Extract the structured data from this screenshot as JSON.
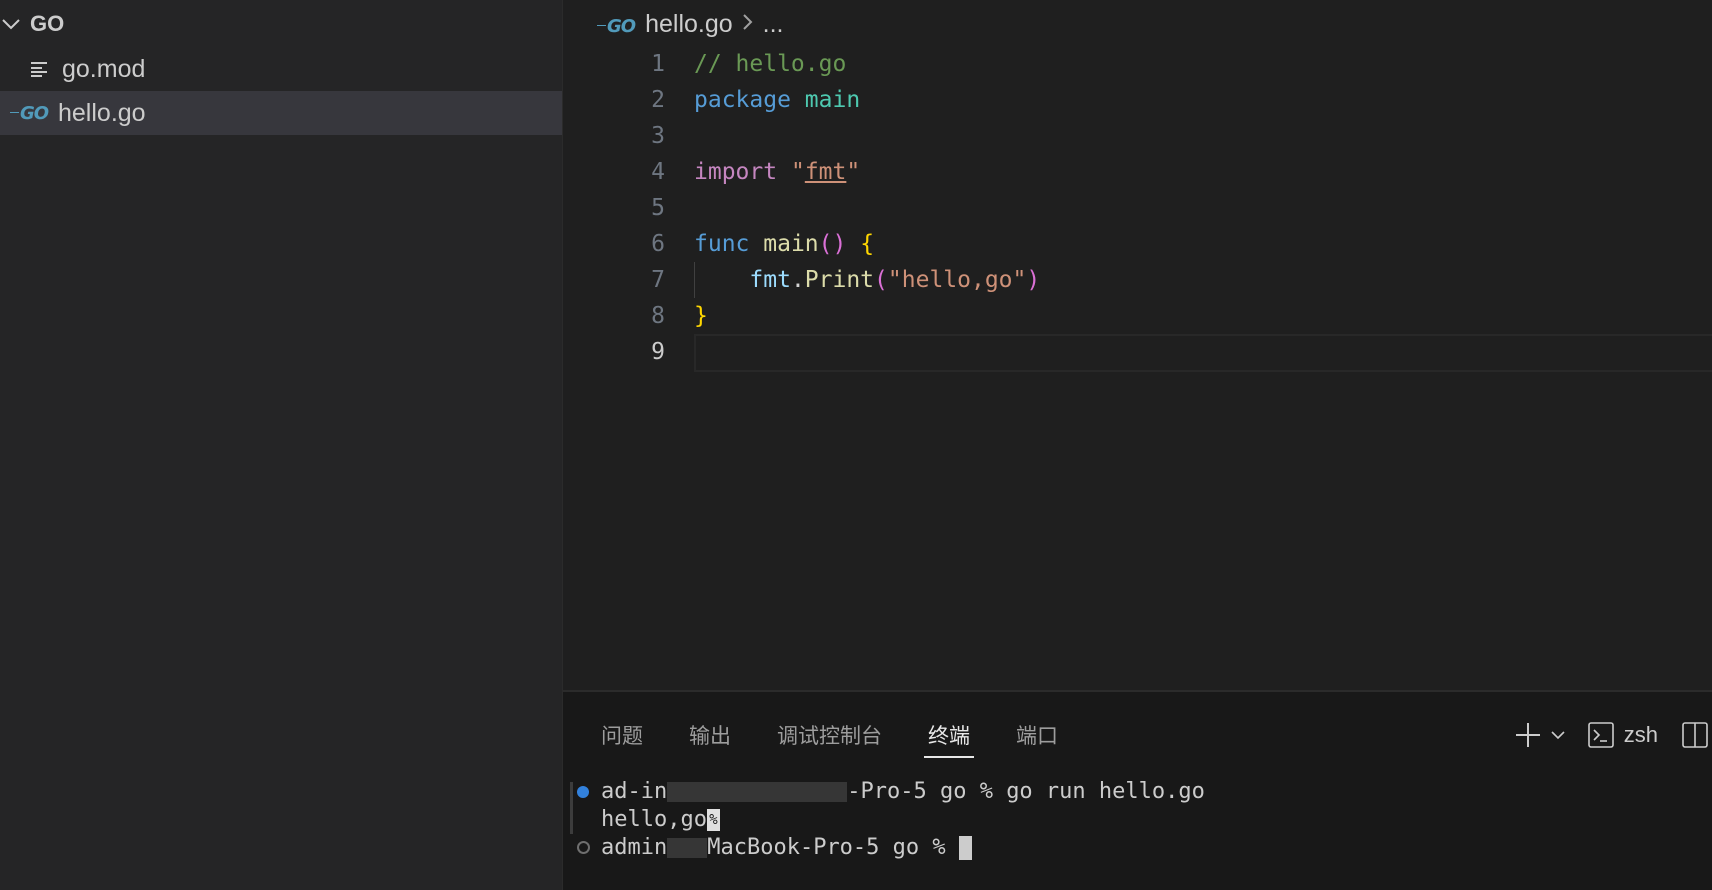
{
  "explorer": {
    "folder_name": "GO",
    "items": [
      {
        "label": "go.mod",
        "icon": "file-lines-icon"
      },
      {
        "label": "hello.go",
        "icon": "go-file-icon",
        "selected": true
      }
    ]
  },
  "editor": {
    "breadcrumb": {
      "file": "hello.go",
      "rest": "..."
    },
    "line_numbers": [
      "1",
      "2",
      "3",
      "4",
      "5",
      "6",
      "7",
      "8",
      "9"
    ],
    "current_line": "9",
    "code": {
      "l1_comment": "// hello.go",
      "l2_kw": "package",
      "l2_name": "main",
      "l4_kw": "import",
      "l4_q1": "\"",
      "l4_pkg": "fmt",
      "l4_q2": "\"",
      "l6_kw": "func",
      "l6_name": "main",
      "l6_parens": "()",
      "l6_brace": "{",
      "l7_pkg": "fmt",
      "l7_dot": ".",
      "l7_fn": "Print",
      "l7_open": "(",
      "l7_str": "\"hello,go\"",
      "l7_close": ")",
      "l8_brace": "}"
    }
  },
  "panel": {
    "tabs": [
      "问题",
      "输出",
      "调试控制台",
      "终端",
      "端口"
    ],
    "active_tab": "终端",
    "shell": "zsh",
    "terminal": {
      "line1_start": "ad-in",
      "line1_mid": "-Pro-5",
      "line1_end": " go % go run hello.go",
      "line2": "hello,go",
      "line2_mark": "%",
      "line3_start": "admin",
      "line3_mid": "MacBook-Pro-5",
      "line3_end": " go % "
    }
  },
  "colors": {
    "editor_bg": "#1f1f1f",
    "sidebar_bg": "#252526",
    "selection_bg": "#37373d",
    "go_blue": "#519aba",
    "comment": "#6a9955",
    "keyword": "#569cd6",
    "string": "#ce9178"
  }
}
